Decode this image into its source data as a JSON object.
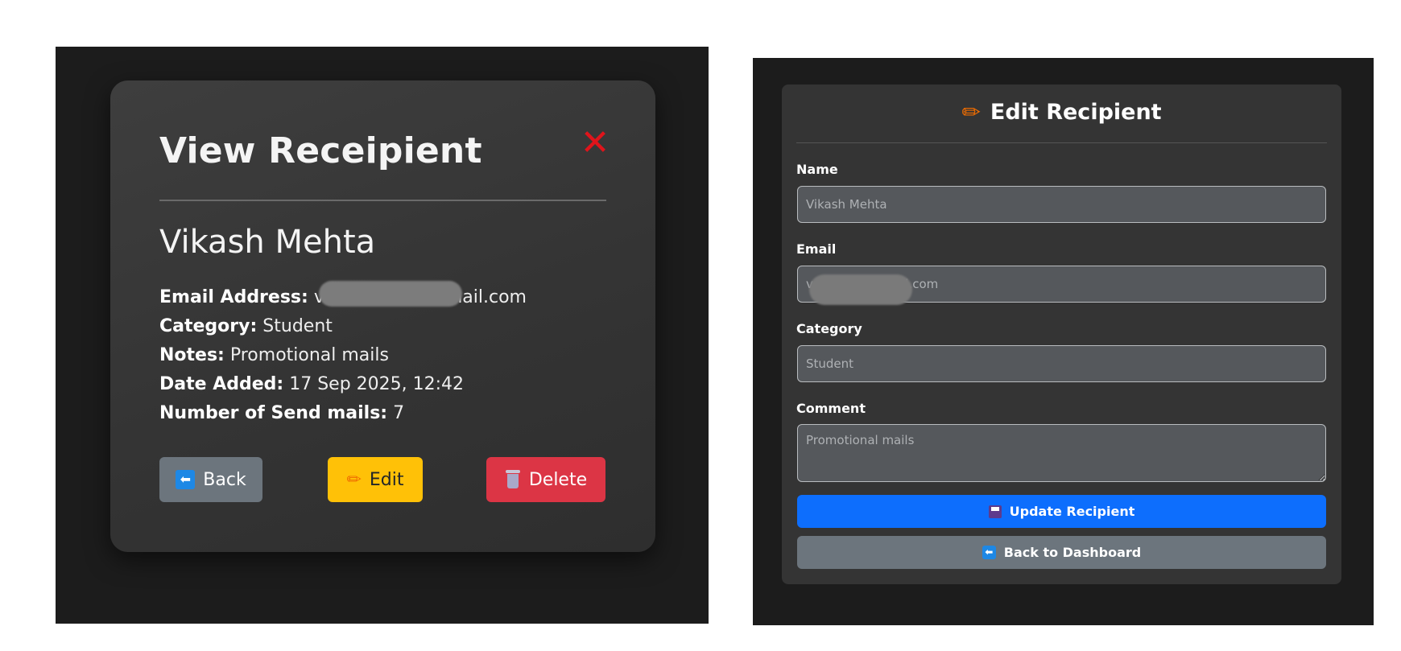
{
  "view_panel": {
    "title": "View Receipient",
    "close_symbol": "✕",
    "recipient_name": "Vikash Mehta",
    "details": [
      {
        "label": "Email Address:",
        "value": "v",
        "value_tail": "mail.com"
      },
      {
        "label": "Category:",
        "value": "Student"
      },
      {
        "label": "Notes:",
        "value": "Promotional mails"
      },
      {
        "label": "Date Added:",
        "value": "17 Sep 2025, 12:42"
      },
      {
        "label": "Number of Send mails:",
        "value": "7"
      }
    ],
    "buttons": {
      "back": "Back",
      "edit": "Edit",
      "delete": "Delete"
    },
    "icons": {
      "back": "left-arrow-icon",
      "edit": "pencil-icon",
      "delete": "wastebasket-icon",
      "close": "close-icon"
    },
    "colors": {
      "back": "#6c757d",
      "edit": "#ffc107",
      "delete": "#dc3545",
      "close": "#e0141b"
    }
  },
  "edit_panel": {
    "title": "Edit Recipient",
    "fields": {
      "name": {
        "label": "Name",
        "placeholder": "Vikash Mehta"
      },
      "email": {
        "label": "Email",
        "placeholder": "v                        l.com"
      },
      "category": {
        "label": "Category",
        "placeholder": "Student"
      },
      "comment": {
        "label": "Comment",
        "placeholder": "Promotional mails"
      }
    },
    "buttons": {
      "update": "Update Recipient",
      "dashboard": "Back to Dashboard"
    },
    "icons": {
      "title": "pencil-icon",
      "update": "floppy-disk-icon",
      "dashboard": "left-arrow-icon"
    },
    "colors": {
      "update": "#0d6efd",
      "dashboard": "#6c757d"
    }
  }
}
